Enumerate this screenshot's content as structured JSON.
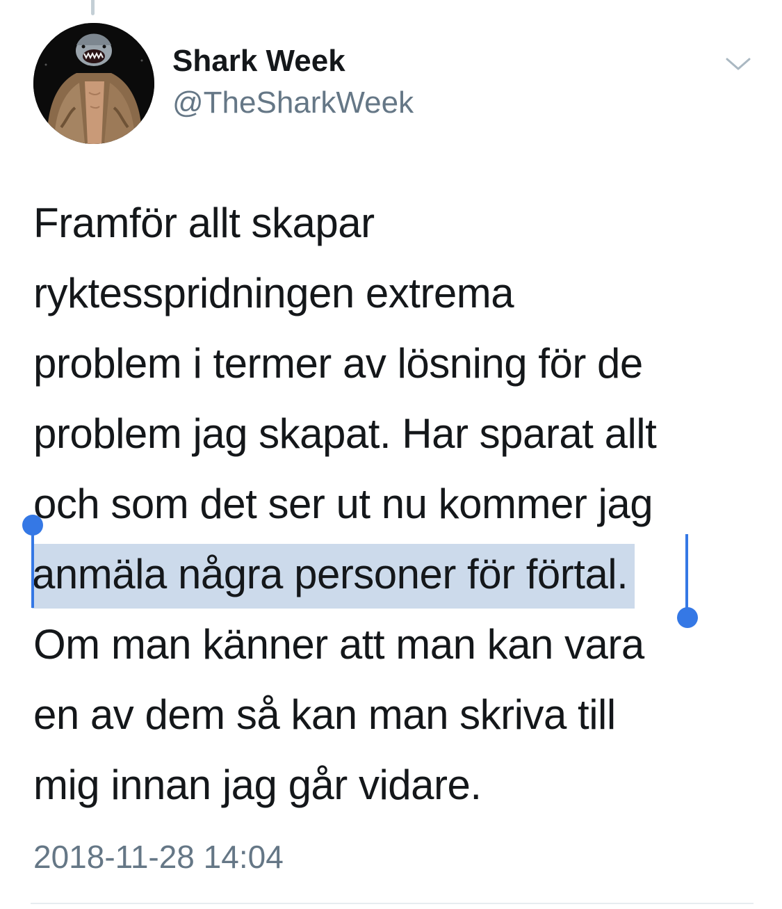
{
  "tweet": {
    "author": {
      "display_name": "Shark Week",
      "handle": "@TheSharkWeek"
    },
    "text_lines": [
      "Framför allt skapar",
      "ryktesspridningen extrema",
      "problem i termer av lösning för de",
      "problem jag skapat. Har sparat allt",
      "och som det ser ut nu kommer jag",
      "anmäla några personer för förtal.",
      "Om man känner att man kan vara",
      "en av dem så kan man skriva till",
      "mig innan jag går vidare."
    ],
    "selected_line_index": 5,
    "timestamp": "2018-11-28 14:04"
  },
  "icons": {
    "menu": "chevron-down-icon",
    "avatar": "avatar-shark-head-fur-coat"
  },
  "colors": {
    "text": "#14171a",
    "secondary_text": "#657786",
    "selection_highlight": "#ccdaeb",
    "selection_handle": "#3578e5",
    "divider": "#e6ecf0",
    "thread_line": "#c4cfd6"
  }
}
